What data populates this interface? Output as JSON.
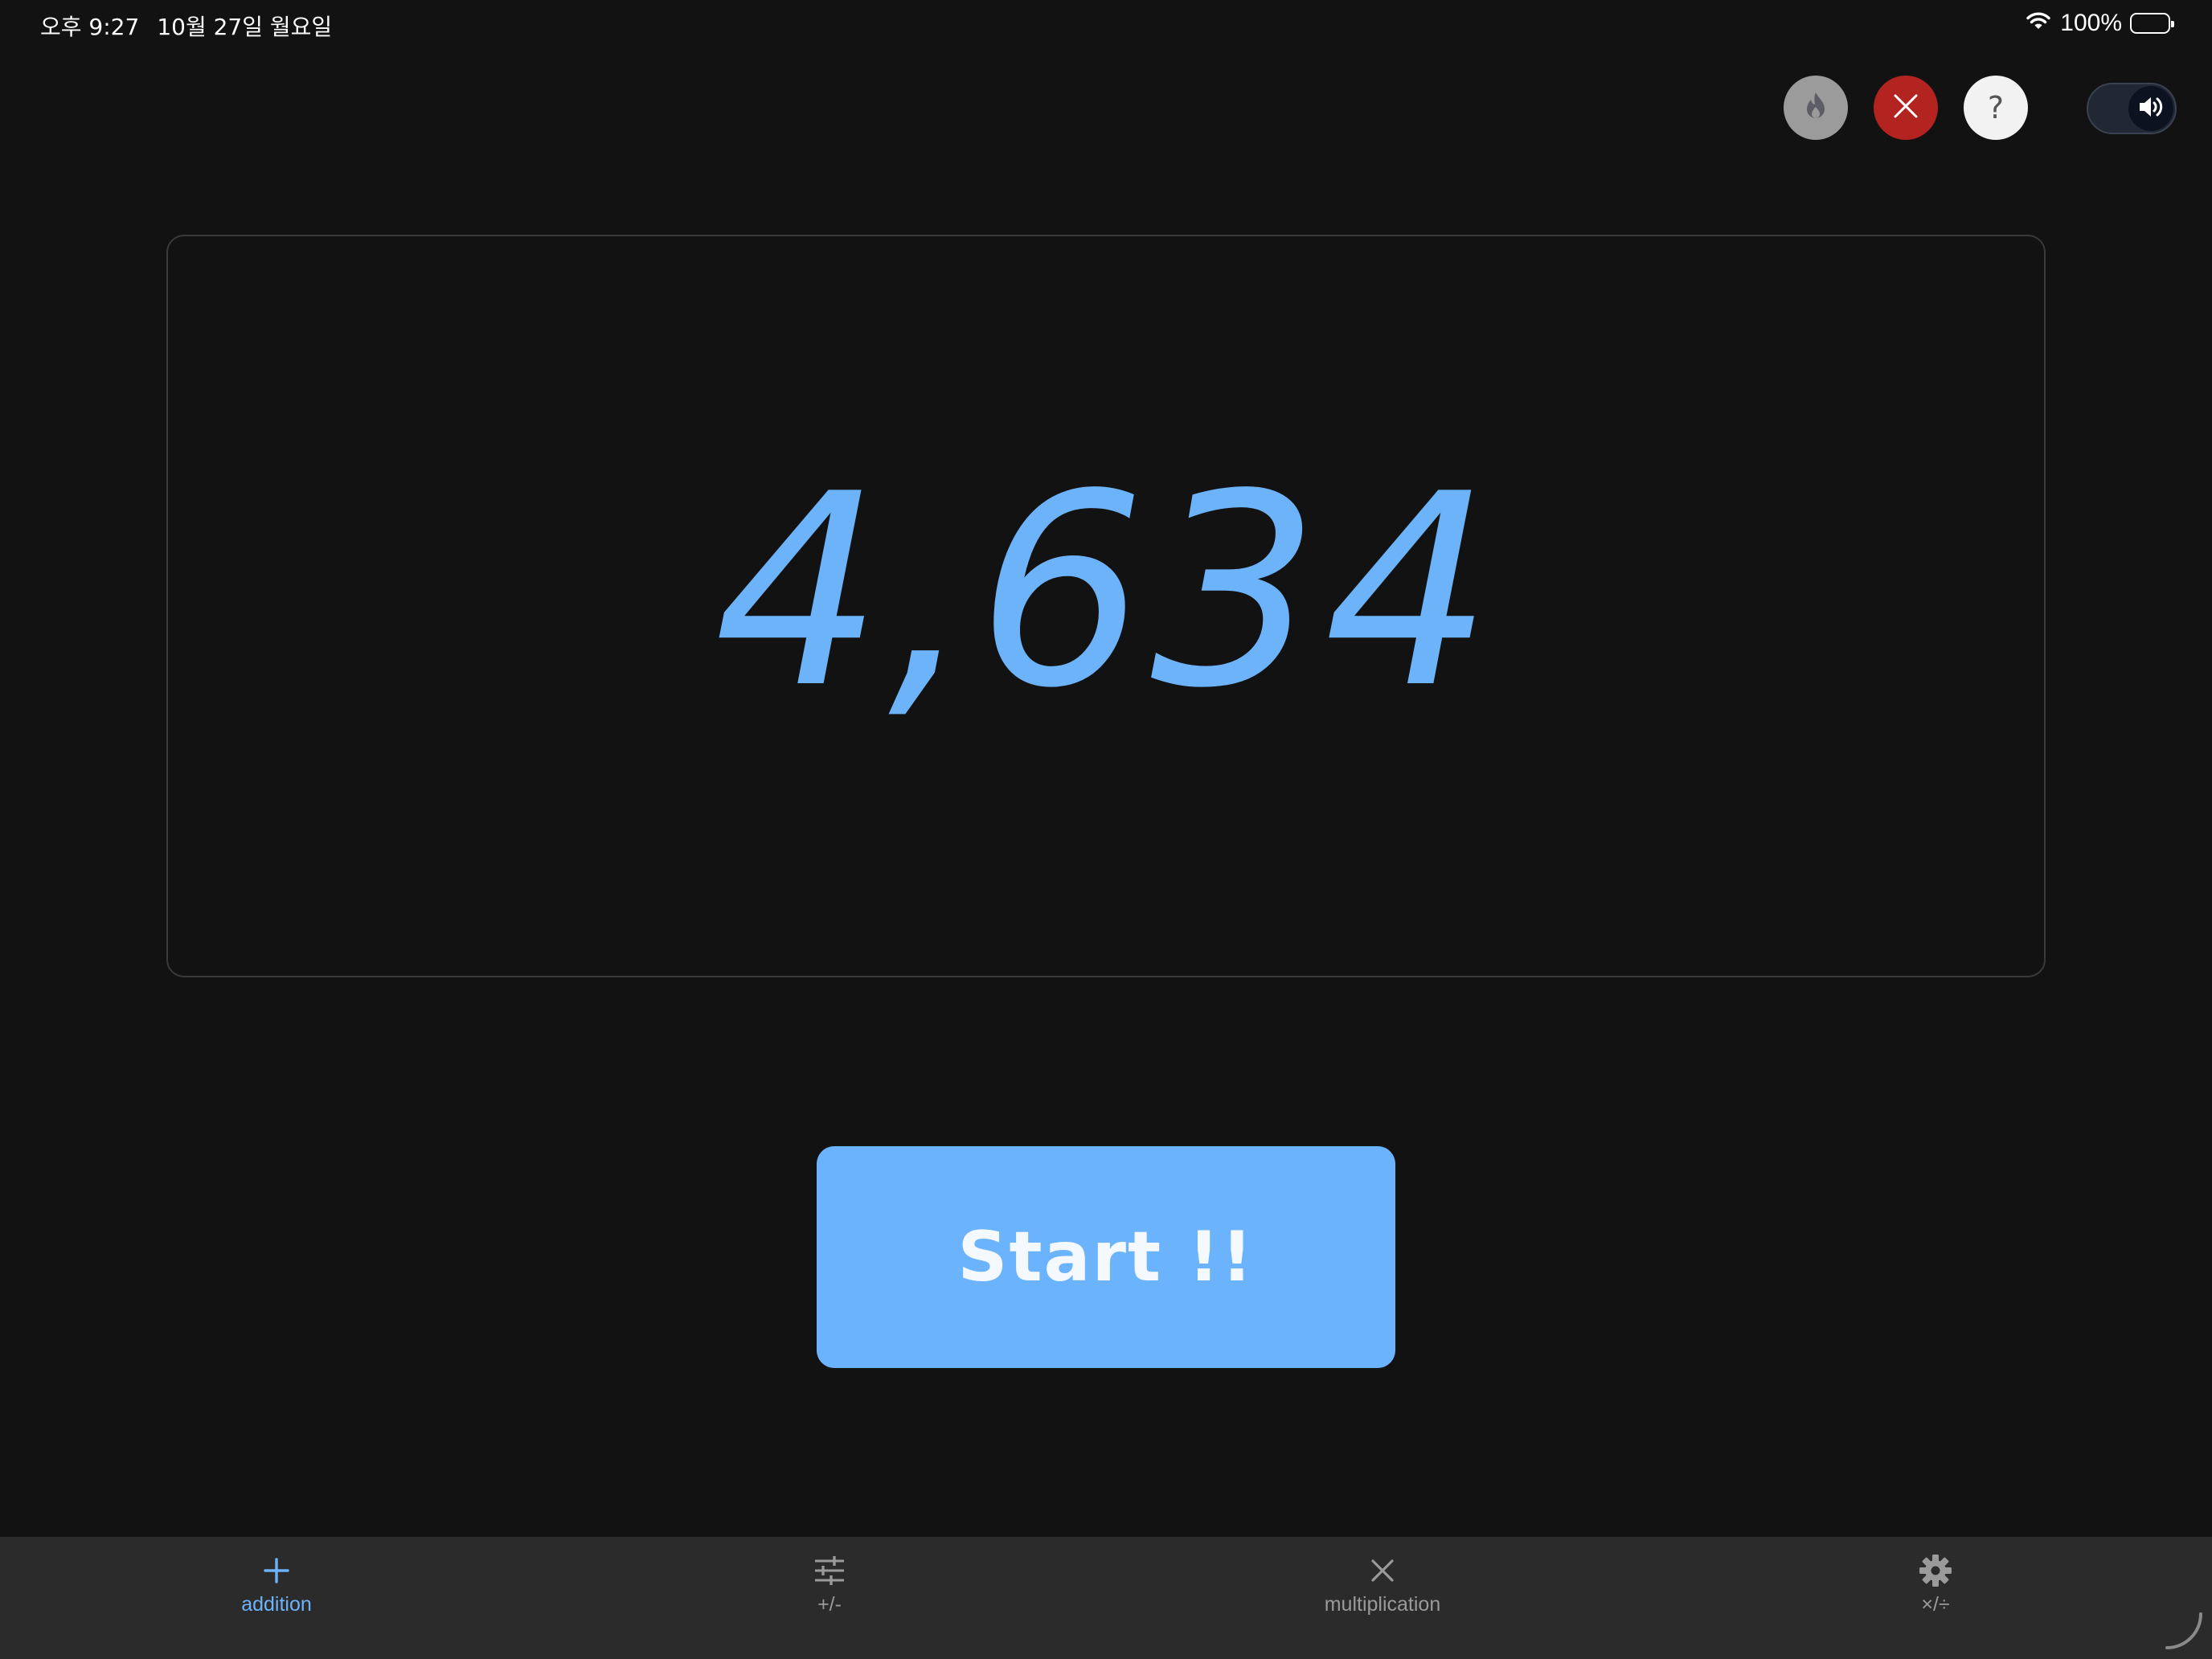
{
  "status_bar": {
    "time": "오후 9:27",
    "date": "10월 27일 월요일",
    "battery": "100%",
    "battery_level": 1.0
  },
  "top_controls": {
    "streak_icon": "flame-icon",
    "close_icon": "close-icon",
    "help_label": "?",
    "sound_toggle_on": true,
    "sound_icon": "speaker-icon"
  },
  "display": {
    "number": "4,634"
  },
  "start_button": {
    "label": "Start !!"
  },
  "tabs": [
    {
      "label": "addition",
      "icon": "plus-icon",
      "active": true
    },
    {
      "label": "+/-",
      "icon": "sliders-icon",
      "active": false
    },
    {
      "label": "multiplication",
      "icon": "multiply-icon",
      "active": false
    },
    {
      "label": "×/÷",
      "icon": "gear-icon",
      "active": false
    }
  ],
  "colors": {
    "background": "#121213",
    "accent": "#6cb3f9",
    "button": "#6cb3fe",
    "close_red": "#b32320",
    "tab_bar": "#2b2b2c"
  }
}
